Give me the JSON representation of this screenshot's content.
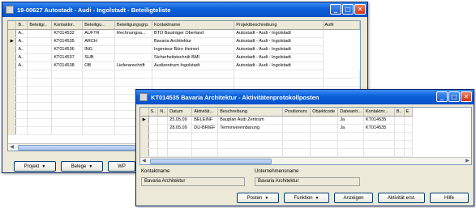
{
  "back_window": {
    "title": "19-00627 Autostadt - Audi - Ingolstadt - Beteiligteliste",
    "columns": [
      "B..",
      "Beteilgr..",
      "Kontaktnr..",
      "Beteiligu...",
      "Beteiligungsgrp.",
      "Kontaktname",
      "Projektbeschreibung",
      "Aufir"
    ],
    "rows": [
      [
        "",
        "A..",
        "",
        "KT014532",
        "AUFTR",
        "Rechnungsa...",
        "BTO Bauträger Oberland",
        "Autostadt - Audi - Ingolstadt"
      ],
      [
        "▶",
        "A..",
        "",
        "KT014535",
        "ARCH",
        "",
        "Bavaria Architektur",
        "Autostadt - Audi - Ingolstadt"
      ],
      [
        "",
        "A..",
        "",
        "KT014536",
        "ING",
        "",
        "Ingenieur Büro Heinert",
        "Autostadt - Audi - Ingolstadt"
      ],
      [
        "",
        "A..",
        "",
        "KT014537",
        "SUB",
        "",
        "Sicherheitstechnik BMI",
        "Autostadt - Audi - Ingolstadt"
      ],
      [
        "",
        "A..",
        "",
        "KT014538",
        "OB",
        "Lieferanschrift",
        "Audizentrum Ingolstadt",
        "Autostadt - Audi - Ingolstadt"
      ]
    ],
    "buttons": {
      "projekt": "Projekt",
      "belege": "Belege",
      "wp": "WP"
    }
  },
  "front_window": {
    "title": "KT014535 Bavaria Architektur - Aktivitätenprotokollposten",
    "columns": [
      "S..",
      "N..",
      "Datum",
      "Aktivität...",
      "Beschreibung",
      "Positionsnr.",
      "Objektcode",
      "Dateianh...",
      "Kontaktnr...",
      "B..",
      "E"
    ],
    "rows": [
      [
        "▶",
        "",
        "",
        "25.05.09",
        "BELEINF",
        "Bauplan Audi Zentrum",
        "",
        "",
        "Ja",
        "KT014535",
        "",
        ""
      ],
      [
        "",
        "",
        "",
        "28.05.09",
        "DU-BRIEF",
        "Terminvereinbarung",
        "",
        "",
        "Ja",
        "KT014535",
        "",
        ""
      ]
    ],
    "fields": {
      "kontaktname_label": "Kontaktname",
      "kontaktname_value": "Bavaria Architektur",
      "unternehmensname_label": "Unternehmensname",
      "unternehmensname_value": "Bavaria Architektur"
    },
    "buttons": {
      "posten": "Posten",
      "funktion": "Funktion",
      "anzeigen": "Anzeigen",
      "aktivitaet": "Aktivität erst.",
      "hilfe": "Hilfe"
    }
  }
}
